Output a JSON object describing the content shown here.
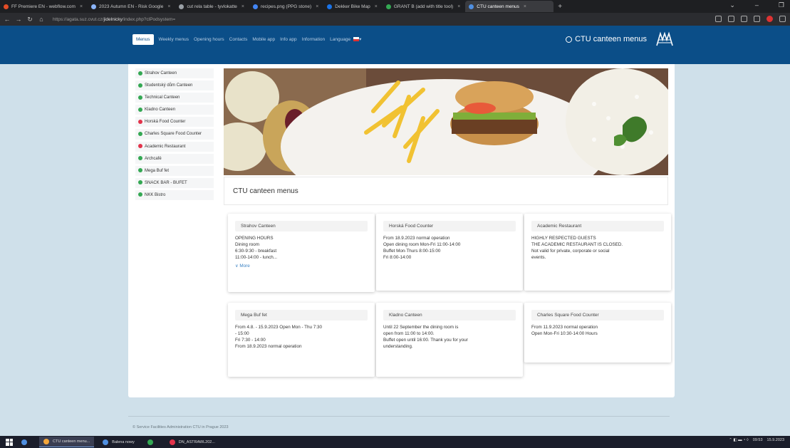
{
  "browser": {
    "tabs": [
      {
        "label": "FF Premiere EN - webflow.com",
        "color": "#e34c26"
      },
      {
        "label": "2023 Autumn EN - Risk Google",
        "color": "#8ab4f8"
      },
      {
        "label": "cut rela table - tyvlokatte",
        "color": "#9aa0a6"
      },
      {
        "label": "recipes.png (PPG stone)",
        "color": "#4285f4"
      },
      {
        "label": "Dekker Bike Map",
        "color": "#1a73e8"
      },
      {
        "label": "GRANT B (add with title tool)",
        "color": "#34a853"
      },
      {
        "label": "CTU canteen menus",
        "color": "#4f8fe0",
        "active": true
      }
    ],
    "url_prefix": "https://agata.suz.cvut.cz/",
    "url_host": "jidelnicky",
    "url_rest": "/index.php?clPodsystem=",
    "window_controls": [
      "⌄",
      "–",
      "❐"
    ]
  },
  "nav": {
    "items": [
      {
        "label": "Menus",
        "active": true
      },
      {
        "label": "Weekly menus"
      },
      {
        "label": "Opening hours"
      },
      {
        "label": "Contacts"
      },
      {
        "label": "Mobile app"
      },
      {
        "label": "Info app"
      },
      {
        "label": "Information"
      },
      {
        "label": "Language"
      }
    ],
    "brand": "CTU canteen menus"
  },
  "sidebar": {
    "items": [
      {
        "label": "Strahov Canteen",
        "status": "green"
      },
      {
        "label": "Studentský dům Canteen",
        "status": "green"
      },
      {
        "label": "Technical Canteen",
        "status": "green"
      },
      {
        "label": "Kladno Canteen",
        "status": "green"
      },
      {
        "label": "Horská Food Counter",
        "status": "red"
      },
      {
        "label": "Charles Square Food Counter",
        "status": "green"
      },
      {
        "label": "Academic Restaurant",
        "status": "red"
      },
      {
        "label": "Archcafé",
        "status": "green"
      },
      {
        "label": "Mega Buf fet",
        "status": "green"
      },
      {
        "label": "SNACK BAR - BUFET",
        "status": "green"
      },
      {
        "label": "NKK Bistro",
        "status": "green"
      }
    ]
  },
  "main": {
    "heading": "CTU canteen menus",
    "cards": [
      {
        "title": "Strahov Canteen",
        "lines": [
          "OPENING HOURS",
          "Dining room",
          "6:30-9:30 - breakfast",
          "11:00-14:00 - lunch..."
        ],
        "more": "∨ More"
      },
      {
        "title": "Horská Food Counter",
        "lines": [
          "From 18.9.2023 normal operation",
          "Open dining room Mon-Fri 11:00-14:00",
          "Buffet Mon-Thurs 8:00-15:00",
          "Fri 8:00-14:00"
        ]
      },
      {
        "title": "Academic Restaurant",
        "lines": [
          "HIGHLY RESPECTED GUESTS",
          "THE ACADEMIC RESTAURANT IS CLOSED.",
          "Not valid for private, corporate or social",
          "events."
        ]
      },
      {
        "title": "Mega Buf fet",
        "lines": [
          "From 4.8. - 15.9.2023 Open Mon - Thu 7:30",
          "- 15:00",
          "Fri 7:30 - 14:00",
          "From 18.9.2023 normal operation"
        ]
      },
      {
        "title": "Kladno Canteen",
        "lines": [
          "Until 22 September the dining room is",
          "open from 11:00 to 14:00.",
          "Buffet open until 16:00. Thank you for your",
          "understanding."
        ]
      },
      {
        "title": "Charles Square Food Counter",
        "lines": [
          "From 11.9.2023 normal operation",
          "Open Mon-Fri 10:30-14:00 Hours"
        ]
      }
    ]
  },
  "footer": "© Service Facilities Administration CTU in Prague 2023",
  "taskbar": {
    "items": [
      {
        "label": "CTU canteen menu...",
        "active": true,
        "color": "#f4a63a"
      },
      {
        "label": "Balena nowy",
        "color": "#4f8fe0"
      },
      {
        "label": "",
        "color": "#34a853"
      },
      {
        "label": "DN_ASTRAWL202...",
        "color": "#e2334b"
      }
    ],
    "time": "09:53",
    "date": "15.9.2023"
  }
}
